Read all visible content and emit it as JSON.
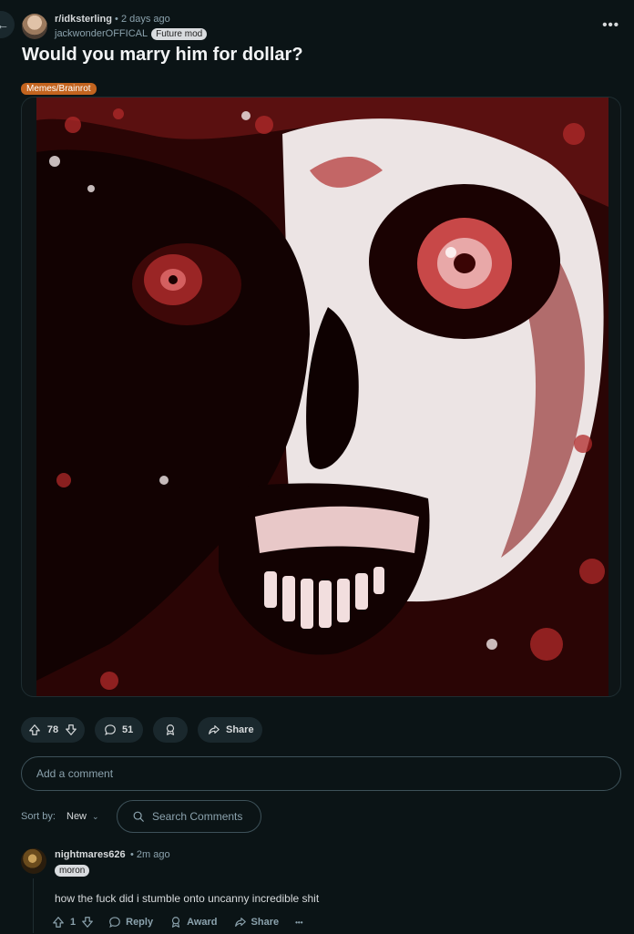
{
  "header": {
    "subreddit": "r/idksterling",
    "separator": "•",
    "time": "2 days ago",
    "author": "jackwonderOFFICAL",
    "author_flair": "Future mod",
    "more": "•••"
  },
  "post": {
    "title": "Would you marry him for dollar?",
    "flair": "Memes/Brainrot",
    "flair_color": "#c3641f"
  },
  "actions": {
    "upvotes": "78",
    "comments": "51",
    "share": "Share"
  },
  "comment_box": {
    "placeholder": "Add a comment"
  },
  "sort": {
    "label": "Sort by:",
    "value": "New"
  },
  "search": {
    "placeholder": "Search Comments"
  },
  "comment": {
    "author": "nightmares626",
    "separator": "•",
    "time": "2m ago",
    "flair": "moron",
    "body": "how the fuck did i stumble onto uncanny incredible shit",
    "votes": "1",
    "reply": "Reply",
    "award": "Award",
    "share": "Share",
    "more": "•••"
  },
  "colors": {
    "background": "#0b1416",
    "pill": "#1a282d",
    "text": "#d7dadc",
    "muted": "#8ba2ad"
  }
}
